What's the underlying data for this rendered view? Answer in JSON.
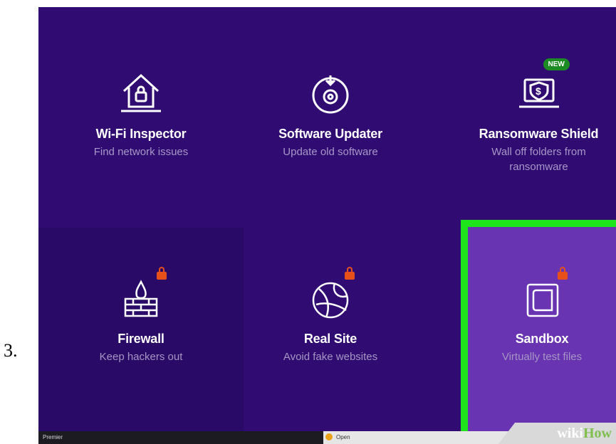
{
  "step_number": "3.",
  "tiles": [
    {
      "title": "Wi-Fi Inspector",
      "desc": "Find network issues",
      "icon": "house-lock-icon"
    },
    {
      "title": "Software Updater",
      "desc": "Update old software",
      "icon": "disc-update-icon"
    },
    {
      "title": "Ransomware Shield",
      "desc": "Wall off folders from ransomware",
      "icon": "laptop-shield-icon",
      "badge": "NEW"
    },
    {
      "title": "Firewall",
      "desc": "Keep hackers out",
      "icon": "firewall-icon",
      "locked": true
    },
    {
      "title": "Real Site",
      "desc": "Avoid fake websites",
      "icon": "globe-icon",
      "locked": true
    },
    {
      "title": "Sandbox",
      "desc": "Virtually test files",
      "icon": "sandbox-icon",
      "locked": true,
      "highlighted": true
    }
  ],
  "taskbar": {
    "left_text": "Premier",
    "open_label": "Open"
  },
  "watermark": {
    "wiki": "wiki",
    "how": "How"
  },
  "colors": {
    "background": "#2f0b72",
    "highlight_border": "#1ee51b",
    "highlight_fill": "#6834b2",
    "lock": "#e8501a",
    "badge": "#1c8b23"
  }
}
